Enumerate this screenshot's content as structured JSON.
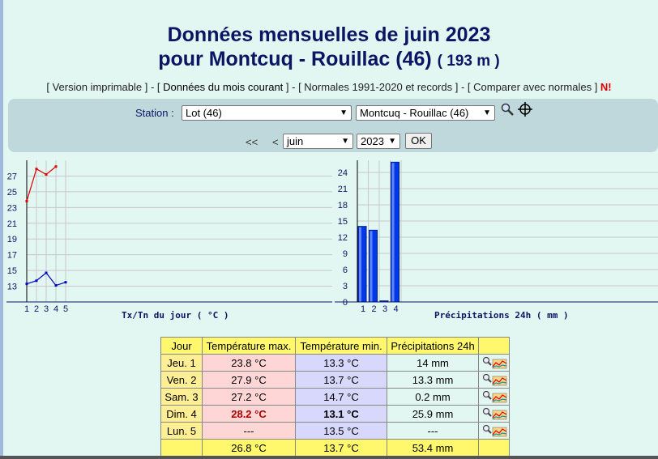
{
  "page": {
    "title_line1": "Données mensuelles de juin 2023",
    "title_line2": "pour Montcuq - Rouillac (46)",
    "altitude": "( 193 m )"
  },
  "links": {
    "printable": "Version imprimable",
    "current": "Données du mois courant",
    "normals": "Normales 1991-2020 et records",
    "compare": "Comparer avec normales",
    "new_badge": "N!"
  },
  "form": {
    "station_label": "Station :",
    "department": "Lot (46)",
    "station": "Montcuq - Rouillac (46)",
    "prev_year": "<<",
    "prev_month": "<",
    "month": "juin",
    "year": "2023",
    "ok": "OK"
  },
  "chart_data": [
    {
      "type": "line",
      "title": "Tx/Tn du jour ( °C )",
      "x": [
        1,
        2,
        3,
        4,
        5
      ],
      "series": [
        {
          "values": [
            23.8,
            27.9,
            27.2,
            28.2,
            null
          ],
          "color": "#e00000"
        },
        {
          "values": [
            13.3,
            13.7,
            14.7,
            13.1,
            13.5
          ],
          "color": "#0000c8"
        }
      ],
      "y_ticks": [
        13,
        15,
        17,
        19,
        21,
        23,
        25,
        27
      ],
      "ylim": [
        11,
        29
      ],
      "grid": true
    },
    {
      "type": "bar",
      "title": "Précipitations 24h ( mm )",
      "categories": [
        "1",
        "2",
        "3",
        "4"
      ],
      "values": [
        14,
        13.3,
        0.2,
        25.9
      ],
      "y_ticks": [
        0,
        3,
        6,
        9,
        12,
        15,
        18,
        21,
        24
      ],
      "ylim": [
        0,
        24
      ],
      "color": "#0038e8",
      "grid": true
    }
  ],
  "table": {
    "headers": [
      "Jour",
      "Température max.",
      "Température min.",
      "Précipitations 24h"
    ],
    "rows": [
      {
        "day": "Jeu. 1",
        "tmax": "23.8 °C",
        "tmin": "13.3 °C",
        "precip": "14 mm"
      },
      {
        "day": "Ven. 2",
        "tmax": "27.9 °C",
        "tmin": "13.7 °C",
        "precip": "13.3 mm"
      },
      {
        "day": "Sam. 3",
        "tmax": "27.2 °C",
        "tmin": "14.7 °C",
        "precip": "0.2 mm"
      },
      {
        "day": "Dim. 4",
        "tmax": "28.2 °C",
        "tmin": "13.1 °C",
        "precip": "25.9 mm"
      },
      {
        "day": "Lun. 5",
        "tmax": "---",
        "tmin": "13.5 °C",
        "precip": "---"
      }
    ],
    "totals": {
      "day": "",
      "tmax": "26.8 °C",
      "tmin": "13.7 °C",
      "precip": "53.4 mm"
    }
  },
  "icons": {
    "zoom": "magnifier-icon",
    "target": "crosshair-icon",
    "mini_chart": "mini-chart-icon"
  }
}
